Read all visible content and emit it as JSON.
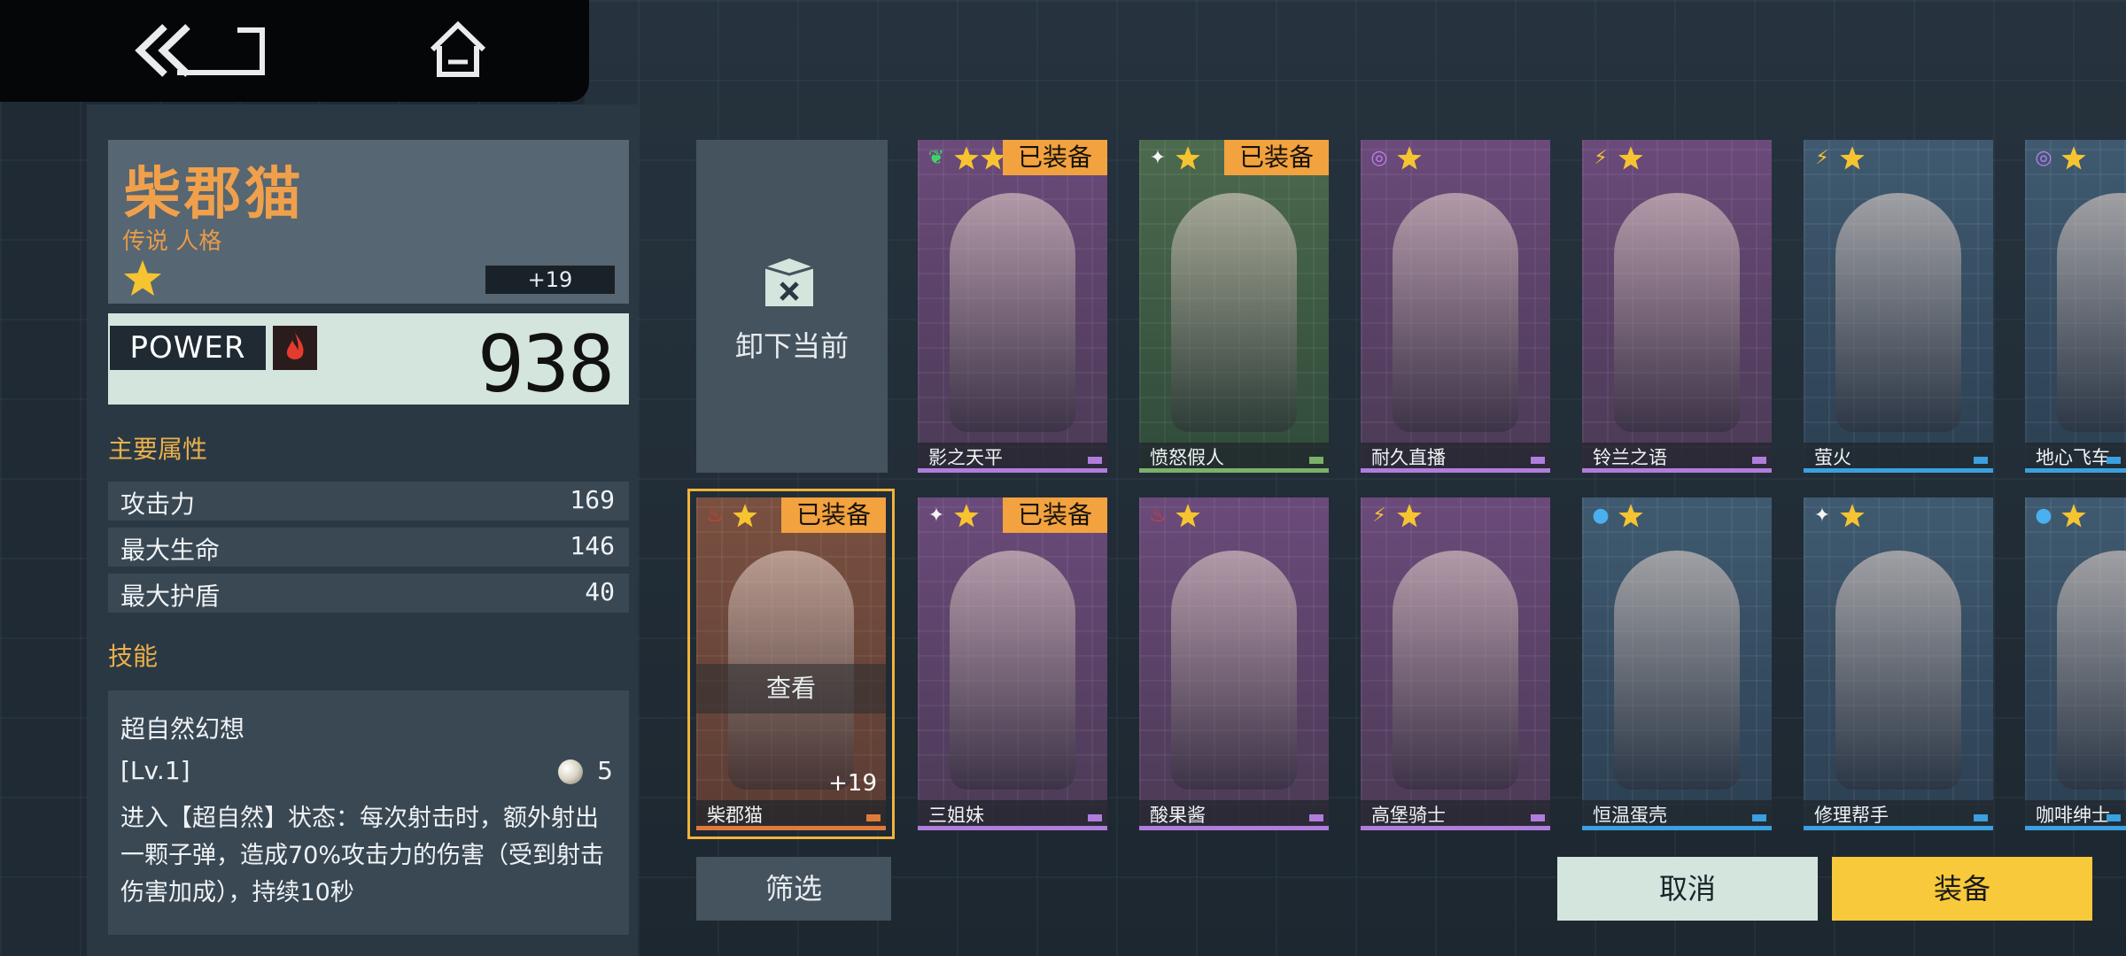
{
  "character": {
    "name": "柴郡猫",
    "rarity": "传说 人格",
    "plus": "+19",
    "power_label": "POWER",
    "power": "938",
    "stars": 1
  },
  "attributes": {
    "title": "主要属性",
    "items": [
      {
        "label": "攻击力",
        "value": "169"
      },
      {
        "label": "最大生命",
        "value": "146"
      },
      {
        "label": "最大护盾",
        "value": "40"
      }
    ]
  },
  "skills": {
    "title": "技能",
    "name": "超自然幻想",
    "level": "[Lv.1]",
    "cost": "5",
    "description": "进入【超自然】状态：每次射击时，额外射出一颗子弹，造成70%攻击力的伤害（受到射击伤害加成），持续10秒"
  },
  "unequip": {
    "label": "卸下当前"
  },
  "filter_label": "筛选",
  "cancel_label": "取消",
  "equip_label": "装备",
  "equipped_badge": "已装备",
  "view_label": "查看",
  "cards": [
    {
      "name": "影之天平",
      "element": "leaf",
      "equipped": true,
      "stars": 2,
      "theme": "purple"
    },
    {
      "name": "愤怒假人",
      "element": "star",
      "equipped": true,
      "stars": 1,
      "theme": "green"
    },
    {
      "name": "耐久直播",
      "element": "spiral",
      "equipped": false,
      "stars": 1,
      "theme": "purple"
    },
    {
      "name": "铃兰之语",
      "element": "bolt",
      "equipped": false,
      "stars": 1,
      "theme": "purple"
    },
    {
      "name": "萤火",
      "element": "bolt",
      "equipped": false,
      "stars": 1,
      "theme": "blue"
    },
    {
      "name": "地心飞车",
      "element": "spiral",
      "equipped": false,
      "stars": 1,
      "theme": "blue"
    },
    {
      "name": "柴郡猫",
      "element": "flame",
      "equipped": true,
      "stars": 1,
      "theme": "orange",
      "plus": "+19",
      "selected": true
    },
    {
      "name": "三姐妹",
      "element": "star",
      "equipped": true,
      "stars": 1,
      "theme": "purple"
    },
    {
      "name": "酸果酱",
      "element": "flame",
      "equipped": false,
      "stars": 1,
      "theme": "purple"
    },
    {
      "name": "高堡骑士",
      "element": "bolt",
      "equipped": false,
      "stars": 1,
      "theme": "purple"
    },
    {
      "name": "恒温蛋壳",
      "element": "drop",
      "equipped": false,
      "stars": 1,
      "theme": "blue"
    },
    {
      "name": "修理帮手",
      "element": "star",
      "equipped": false,
      "stars": 1,
      "theme": "blue"
    },
    {
      "name": "咖啡绅士",
      "element": "drop",
      "equipped": false,
      "stars": 1,
      "theme": "blue"
    }
  ],
  "colors": {
    "accent": "#f0a04b",
    "equipped_badge": "#f2a23e",
    "equip_button": "#f8c93a",
    "power_bg": "#d3e5dc"
  }
}
